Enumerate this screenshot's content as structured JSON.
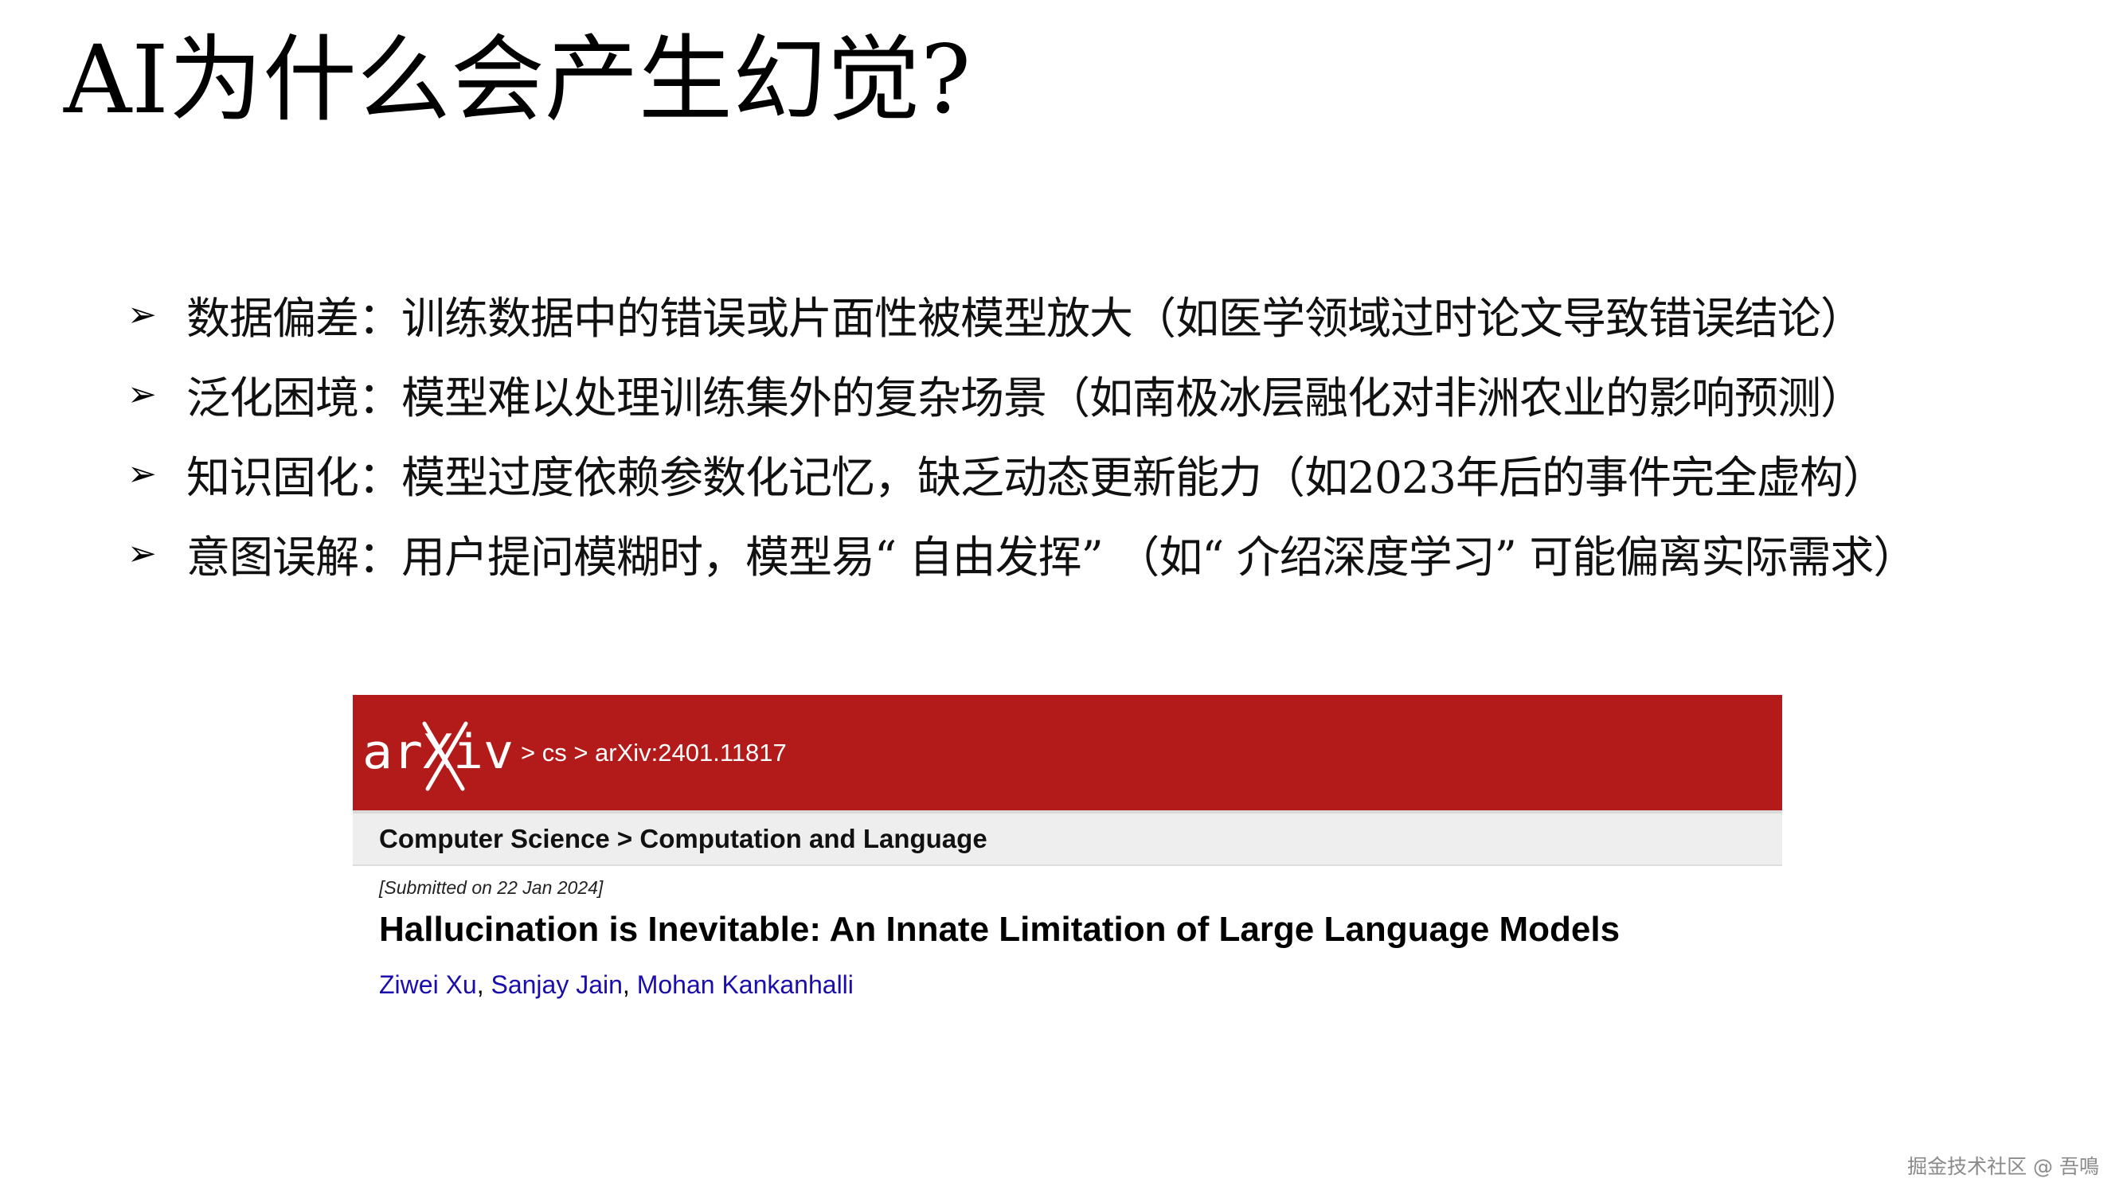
{
  "slide": {
    "title": "AI为什么会产生幻觉?",
    "bullet_marker": "➢",
    "bullets": [
      "数据偏差：训练数据中的错误或片面性被模型放大（如医学领域过时论文导致错误结论）",
      "泛化困境：模型难以处理训练集外的复杂场景（如南极冰层融化对非洲农业的影响预测）",
      "知识固化：模型过度依赖参数化记忆，缺乏动态更新能力（如2023年后的事件完全虚构）",
      "意图误解：用户提问模糊时，模型易“ 自由发挥” （如“ 介绍深度学习” 可能偏离实际需求）"
    ]
  },
  "arxiv": {
    "logo_text": "arXiv",
    "breadcrumb": "> cs > arXiv:2401.11817",
    "subject": "Computer Science > Computation and Language",
    "submitted": "[Submitted on 22 Jan 2024]",
    "title": "Hallucination is Inevitable: An Innate Limitation of Large Language Models",
    "authors": [
      "Ziwei Xu",
      "Sanjay Jain",
      "Mohan Kankanhalli"
    ],
    "author_separator": ", ",
    "colors": {
      "header": "#b31b1b",
      "link": "#1a0dab"
    }
  },
  "watermark": "掘金技术社区 @ 吾鳴"
}
